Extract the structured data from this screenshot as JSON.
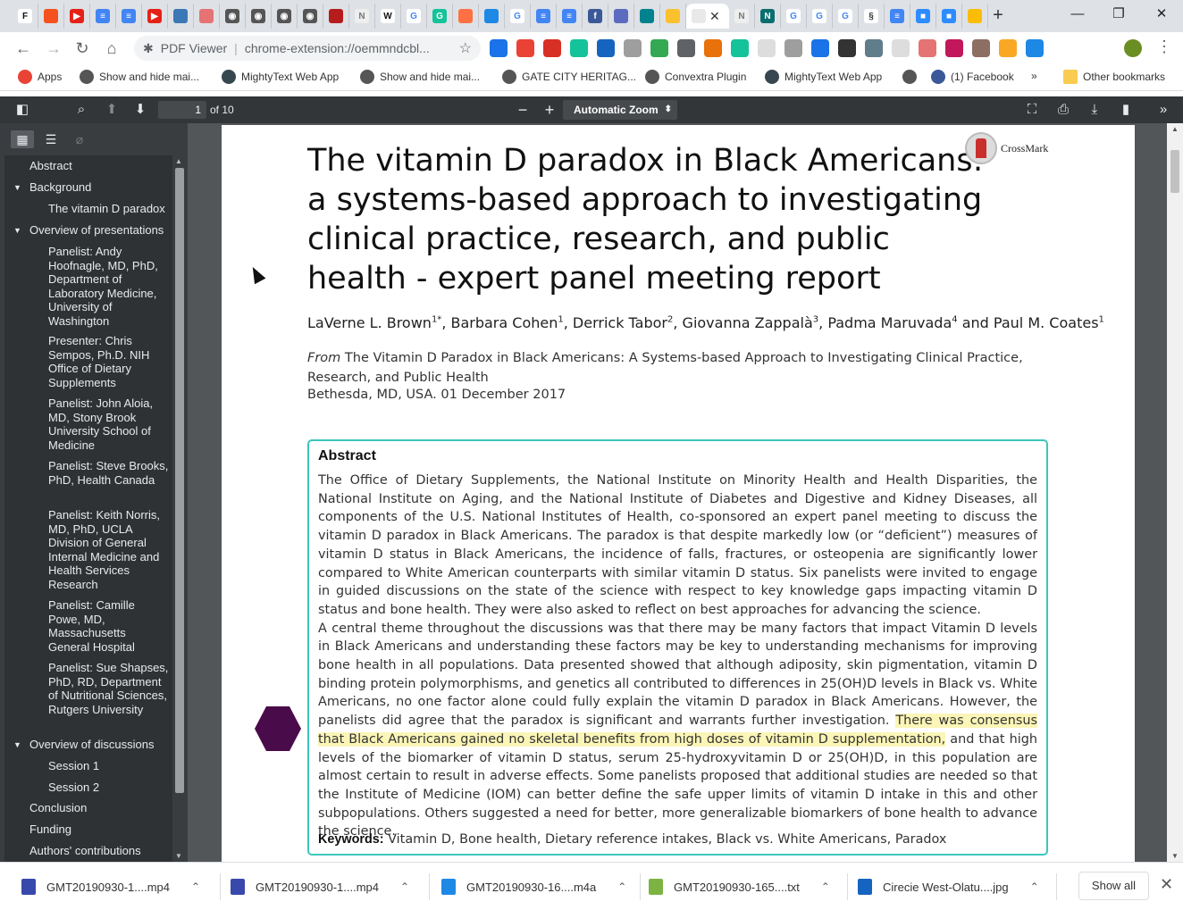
{
  "browser": {
    "tabs": [
      {
        "name": "tab-f",
        "glyph": "F",
        "color": "#ffffff",
        "textcolor": "#111111"
      },
      {
        "name": "tab-orange",
        "glyph": "",
        "color": "#f4511e"
      },
      {
        "name": "tab-youtube-1",
        "glyph": "▶",
        "color": "#e62117"
      },
      {
        "name": "tab-docs-1",
        "glyph": "≡",
        "color": "#4285f4"
      },
      {
        "name": "tab-docs-2",
        "glyph": "≡",
        "color": "#4285f4"
      },
      {
        "name": "tab-youtube-2",
        "glyph": "▶",
        "color": "#e62117"
      },
      {
        "name": "tab-bank",
        "glyph": "",
        "color": "#3b78b5"
      },
      {
        "name": "tab-pdf",
        "glyph": "",
        "color": "#e57373"
      },
      {
        "name": "tab-generic-1",
        "glyph": "◉",
        "color": "#555555"
      },
      {
        "name": "tab-generic-2",
        "glyph": "◉",
        "color": "#555555"
      },
      {
        "name": "tab-generic-3",
        "glyph": "◉",
        "color": "#555555"
      },
      {
        "name": "tab-generic-4",
        "glyph": "◉",
        "color": "#555555"
      },
      {
        "name": "tab-shield",
        "glyph": "",
        "color": "#b71c1c"
      },
      {
        "name": "tab-nature-1",
        "glyph": "N",
        "color": "#eeeeee",
        "textcolor": "#777777"
      },
      {
        "name": "tab-wikipedia",
        "glyph": "W",
        "color": "#ffffff",
        "textcolor": "#111111"
      },
      {
        "name": "tab-google-1",
        "glyph": "G",
        "color": "#ffffff",
        "textcolor": "#4285f4"
      },
      {
        "name": "tab-grammarly",
        "glyph": "G",
        "color": "#15c39a"
      },
      {
        "name": "tab-orange-circle",
        "glyph": "",
        "color": "#ff7043"
      },
      {
        "name": "tab-blue-circle",
        "glyph": "",
        "color": "#1e88e5"
      },
      {
        "name": "tab-google-2",
        "glyph": "G",
        "color": "#ffffff",
        "textcolor": "#4285f4"
      },
      {
        "name": "tab-docs-3",
        "glyph": "≡",
        "color": "#4285f4"
      },
      {
        "name": "tab-docs-4",
        "glyph": "≡",
        "color": "#4285f4"
      },
      {
        "name": "tab-facebook",
        "glyph": "f",
        "color": "#3b5998"
      },
      {
        "name": "tab-heart",
        "glyph": "",
        "color": "#5c6bc0"
      },
      {
        "name": "tab-teal",
        "glyph": "",
        "color": "#00838f"
      },
      {
        "name": "tab-yellow",
        "glyph": "",
        "color": "#fbc02d"
      },
      {
        "name": "tab-active-pdf",
        "glyph": "",
        "color": "#ffffff",
        "active": true
      },
      {
        "name": "tab-nature-2",
        "glyph": "N",
        "color": "#eeeeee",
        "textcolor": "#777777"
      },
      {
        "name": "tab-ne",
        "glyph": "N",
        "color": "#0b6e6e"
      },
      {
        "name": "tab-google-3",
        "glyph": "G",
        "color": "#ffffff",
        "textcolor": "#4285f4"
      },
      {
        "name": "tab-google-4",
        "glyph": "G",
        "color": "#ffffff",
        "textcolor": "#4285f4"
      },
      {
        "name": "tab-google-5",
        "glyph": "G",
        "color": "#ffffff",
        "textcolor": "#4285f4"
      },
      {
        "name": "tab-chain",
        "glyph": "§",
        "color": "#ffffff",
        "textcolor": "#333333"
      },
      {
        "name": "tab-docs-5",
        "glyph": "≡",
        "color": "#4285f4"
      },
      {
        "name": "tab-zoom-1",
        "glyph": "■",
        "color": "#2d8cff"
      },
      {
        "name": "tab-zoom-2",
        "glyph": "■",
        "color": "#2d8cff"
      },
      {
        "name": "tab-keep",
        "glyph": "",
        "color": "#fbbc04"
      }
    ],
    "omnibox": {
      "site_label": "PDF Viewer",
      "url": "chrome-extension://oemmndcbl..."
    },
    "extensions": [
      "#1a73e8",
      "#ea4335",
      "#d93025",
      "#15c39a",
      "#1565c0",
      "#9e9e9e",
      "#34a853",
      "#5f6368",
      "#e8710a",
      "#15c39a",
      "#dddddd",
      "#9e9e9e",
      "#1a73e8",
      "#333333",
      "#607d8b",
      "#dddddd",
      "#e57373",
      "#c2185b",
      "#8d6e63",
      "#f9a825",
      "#1e88e5"
    ],
    "bookmarks": [
      {
        "name": "bookmark-apps",
        "label": "Apps",
        "color": "#ea4335"
      },
      {
        "name": "bookmark-show-hide-1",
        "label": "Show and hide mai...",
        "color": "#555555"
      },
      {
        "name": "bookmark-mightytext-1",
        "label": "MightyText Web App",
        "color": "#37474f"
      },
      {
        "name": "bookmark-show-hide-2",
        "label": "Show and hide mai...",
        "color": "#555555"
      },
      {
        "name": "bookmark-gate-city",
        "label": "GATE CITY HERITAG...",
        "color": "#555555"
      },
      {
        "name": "bookmark-convextra",
        "label": "Convextra Plugin",
        "color": "#555555"
      },
      {
        "name": "bookmark-mightytext-2",
        "label": "MightyText Web App",
        "color": "#37474f"
      },
      {
        "name": "bookmark-blank",
        "label": "",
        "color": "#555555"
      },
      {
        "name": "bookmark-facebook",
        "label": "(1) Facebook",
        "color": "#3b5998"
      }
    ],
    "bookmarks_more": "»",
    "other_bookmarks": "Other bookmarks"
  },
  "pdf_toolbar": {
    "page_current": "1",
    "page_total_label": "of 10",
    "zoom_label": "Automatic Zoom",
    "zoom_out": "−",
    "zoom_in": "+"
  },
  "sidebar": {
    "outline": [
      {
        "label": "Abstract",
        "level": 0,
        "toggle": false
      },
      {
        "label": "Background",
        "level": 0,
        "toggle": true
      },
      {
        "label": "The vitamin D paradox",
        "level": 1,
        "toggle": false
      },
      {
        "label": "Overview of presentations",
        "level": 0,
        "toggle": true
      },
      {
        "label": "Panelist: Andy Hoofnagle, MD, PhD, Department of Laboratory Medicine, University of Washington",
        "level": 1,
        "toggle": false
      },
      {
        "label": "Presenter: Chris Sempos, Ph.D. NIH Office of Dietary Supplements",
        "level": 1,
        "toggle": false
      },
      {
        "label": "Panelist: John Aloia, MD, Stony Brook University School of Medicine",
        "level": 1,
        "toggle": false
      },
      {
        "label": "Panelist: Steve Brooks, PhD, Health Canada",
        "level": 1,
        "toggle": false
      },
      {
        "label": "Panelist: Keith Norris, MD, PhD, UCLA Division of General Internal Medicine and Health Services Research",
        "level": 1,
        "toggle": false
      },
      {
        "label": "Panelist: Camille Powe, MD, Massachusetts General Hospital",
        "level": 1,
        "toggle": false
      },
      {
        "label": "Panelist: Sue Shapses, PhD, RD, Department of Nutritional Sciences, Rutgers University",
        "level": 1,
        "toggle": false
      },
      {
        "label": "Overview of discussions",
        "level": 0,
        "toggle": true
      },
      {
        "label": "Session 1",
        "level": 1,
        "toggle": false
      },
      {
        "label": "Session 2",
        "level": 1,
        "toggle": false
      },
      {
        "label": "Conclusion",
        "level": 0,
        "toggle": false
      },
      {
        "label": "Funding",
        "level": 0,
        "toggle": false
      },
      {
        "label": "Authors' contributions",
        "level": 0,
        "toggle": false
      }
    ]
  },
  "document": {
    "title": "The vitamin D paradox in Black Americans: a systems-based approach to investigating clinical practice, research, and public health - expert panel meeting report",
    "crossmark": "CrossMark",
    "authors": [
      {
        "name": "LaVerne L. Brown",
        "sup": "1*"
      },
      {
        "name": "Barbara Cohen",
        "sup": "1"
      },
      {
        "name": "Derrick Tabor",
        "sup": "2"
      },
      {
        "name": "Giovanna Zappalà",
        "sup": "3"
      },
      {
        "name": "Padma Maruvada",
        "sup": "4"
      },
      {
        "name": "Paul M. Coates",
        "sup": "1"
      }
    ],
    "authors_conjunction": "and",
    "from_label": "From",
    "from_text": "The Vitamin D Paradox in Black Americans: A Systems-based Approach to Investigating Clinical Practice, Research, and Public Health",
    "location_date": "Bethesda, MD, USA. 01 December 2017",
    "abstract": {
      "heading": "Abstract",
      "p1": "The Office of Dietary Supplements, the National Institute on Minority Health and Health Disparities, the National Institute on Aging, and the National Institute of Diabetes and Digestive and Kidney Diseases, all components of the U.S. National Institutes of Health, co-sponsored an expert panel meeting to discuss the vitamin D paradox in Black Americans. The paradox is that despite markedly low (or “deficient”) measures of vitamin D status in Black Americans, the incidence of falls, fractures, or osteopenia are significantly lower compared to White American counterparts with similar vitamin D status. Six panelists were invited to engage in guided discussions on the state of the science with respect to key knowledge gaps impacting vitamin D status and bone health. They were also asked to reflect on best approaches for advancing the science.",
      "p2_before": "A central theme throughout the discussions was that there may be many factors that impact Vitamin D levels in Black Americans and understanding these factors may be key to understanding mechanisms for improving bone health in all populations. Data presented showed that although adiposity, skin pigmentation, vitamin D binding protein polymorphisms, and genetics all contributed to differences in 25(OH)D levels in Black vs. White Americans, no one factor alone could fully explain the vitamin D paradox in Black Americans. However, the panelists did agree that the paradox is significant and warrants further investigation.",
      "p2_highlight": "There was consensus that Black Americans gained no skeletal benefits from high doses of vitamin D supplementation,",
      "p2_after": "and that high levels of the biomarker of vitamin D status, serum 25-hydroxyvitamin D or 25(OH)D, in this population are almost certain to result in adverse effects. Some panelists proposed that additional studies are needed so that the Institute of Medicine (IOM) can better define the safe upper limits of vitamin D intake in this and other subpopulations. Others suggested a need for better, more generalizable biomarkers of bone health to advance the science.",
      "keywords_label": "Keywords:",
      "keywords": "Vitamin D, Bone health, Dietary reference intakes, Black vs. White Americans, Paradox"
    }
  },
  "downloads": {
    "items": [
      {
        "name": "download-mp4-1",
        "label": "GMT20190930-1....mp4",
        "color": "#3949ab"
      },
      {
        "name": "download-mp4-2",
        "label": "GMT20190930-1....mp4",
        "color": "#3949ab"
      },
      {
        "name": "download-m4a",
        "label": "GMT20190930-16....m4a",
        "color": "#1e88e5"
      },
      {
        "name": "download-txt",
        "label": "GMT20190930-165....txt",
        "color": "#7cb342"
      },
      {
        "name": "download-jpg",
        "label": "Cirecie West-Olatu....jpg",
        "color": "#1565c0"
      }
    ],
    "show_all": "Show all"
  },
  "accent_colors": {
    "abstract_border": "#3cc6bd",
    "highlight": "#fbf5b7",
    "pdf_toolbar": "#323639",
    "hexagon": "#4a0b4a"
  }
}
